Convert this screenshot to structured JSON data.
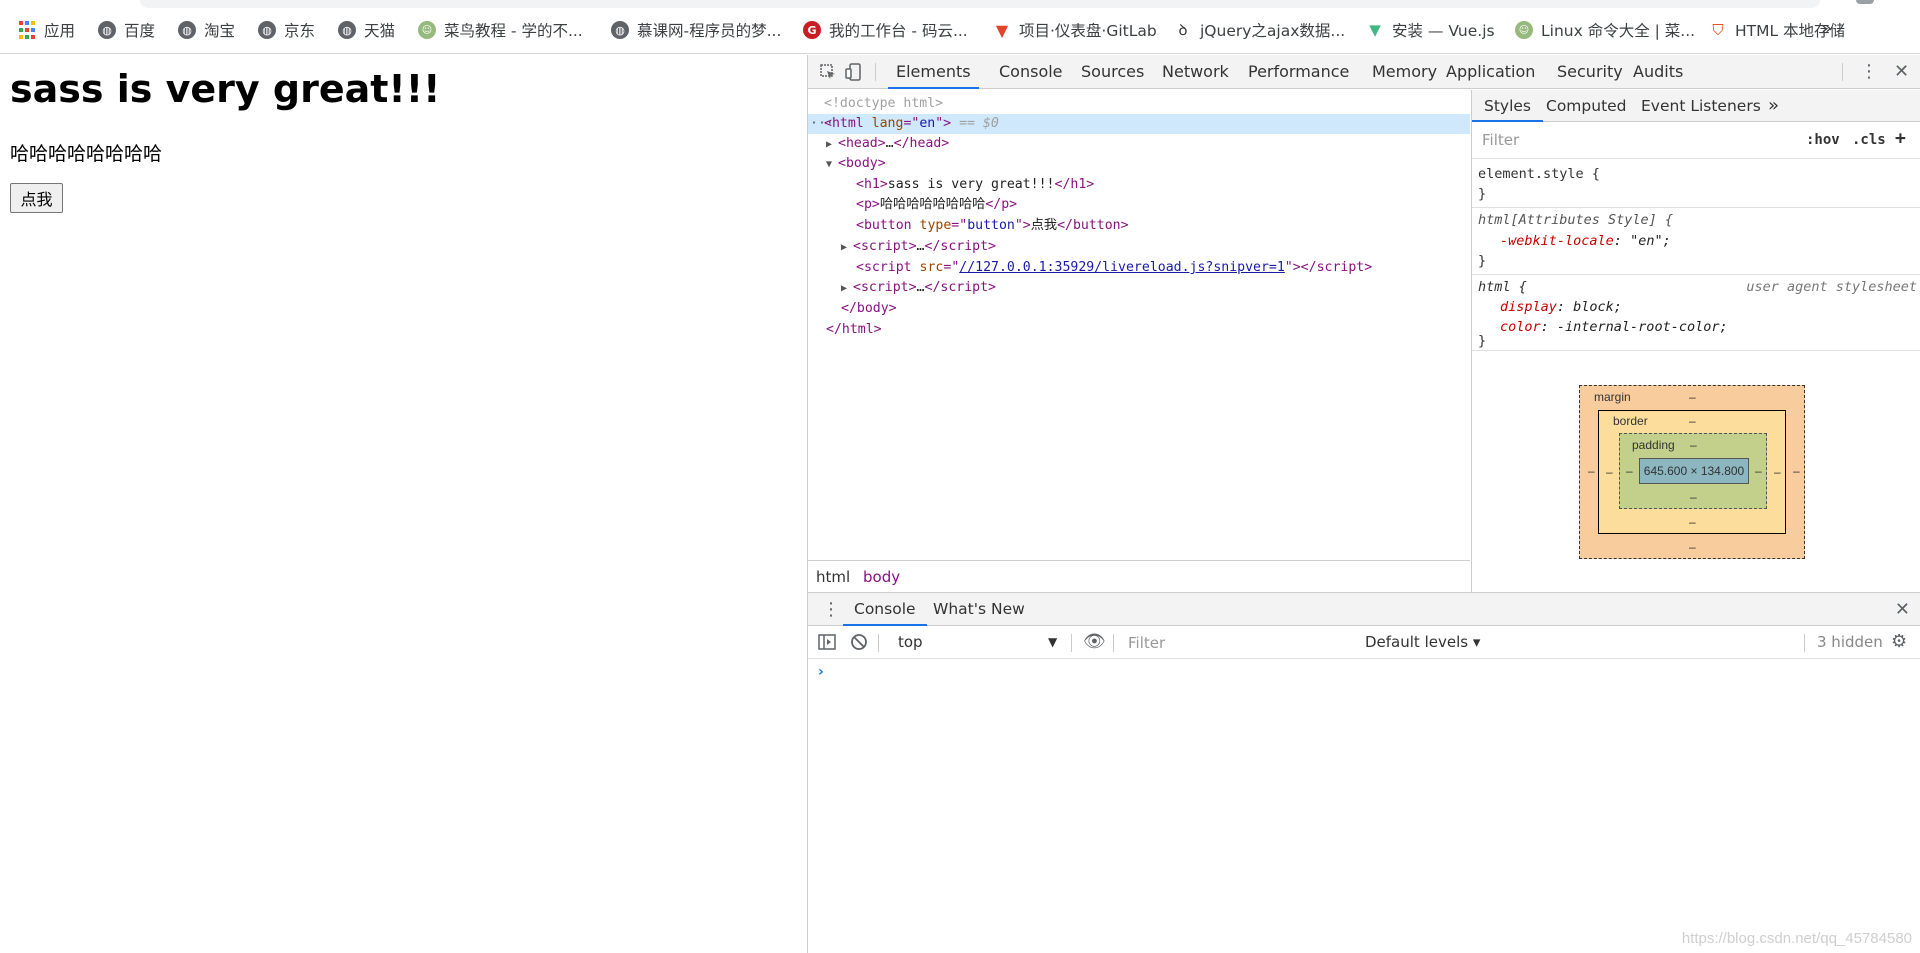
{
  "bookmarks": {
    "items": [
      {
        "label": "应用",
        "icon": "apps-grid-icon"
      },
      {
        "label": "百度",
        "icon": "globe-icon"
      },
      {
        "label": "淘宝",
        "icon": "globe-icon"
      },
      {
        "label": "京东",
        "icon": "globe-icon"
      },
      {
        "label": "天猫",
        "icon": "globe-icon"
      },
      {
        "label": "菜鸟教程 - 学的不...",
        "icon": "runoob-icon"
      },
      {
        "label": "慕课网-程序员的梦...",
        "icon": "globe-icon"
      },
      {
        "label": "我的工作台 - 码云...",
        "icon": "gitee-icon"
      },
      {
        "label": "项目·仪表盘·GitLab",
        "icon": "gitlab-icon"
      },
      {
        "label": "jQuery之ajax数据...",
        "icon": "bookmark-icon"
      },
      {
        "label": "安装 — Vue.js",
        "icon": "vue-icon"
      },
      {
        "label": "Linux 命令大全 | 菜...",
        "icon": "runoob-icon"
      },
      {
        "label": "HTML 本地存储",
        "icon": "html5-icon"
      }
    ],
    "more": "»"
  },
  "page": {
    "heading": "sass is very great!!!",
    "paragraph": "哈哈哈哈哈哈哈哈",
    "button": "点我"
  },
  "devtools": {
    "tabs": [
      "Elements",
      "Console",
      "Sources",
      "Network",
      "Performance",
      "Memory",
      "Application",
      "Security",
      "Audits"
    ],
    "active_tab": "Elements",
    "tree": {
      "doctype": "<!doctype html>",
      "html_open_tag": "html",
      "html_lang_attr": "lang",
      "html_lang_val": "en",
      "sel_marker": "== $0",
      "head": "head",
      "body": "body",
      "h1_text": "sass is very great!!!",
      "p_text": "哈哈哈哈哈哈哈哈",
      "button_type_attr": "type",
      "button_type_val": "button",
      "button_text": "点我",
      "script": "script",
      "script_src_attr": "src",
      "script_src_val": "//127.0.0.1:35929/livereload.js?snipver=1",
      "ellipsis": "…"
    },
    "breadcrumb": [
      "html",
      "body"
    ],
    "styles": {
      "tabs": [
        "Styles",
        "Computed",
        "Event Listeners",
        "»"
      ],
      "filter_placeholder": "Filter",
      "hov": ":hov",
      "cls": ".cls",
      "plus": "+",
      "rules": {
        "element_style": "element.style {",
        "attr_style_selector": "html[Attributes Style] {",
        "webkit_locale_prop": "-webkit-locale",
        "webkit_locale_val": "\"en\";",
        "html_selector": "html {",
        "ua_label": "user agent stylesheet",
        "display_prop": "display",
        "display_val": "block;",
        "color_prop": "color",
        "color_val": "-internal-root-color;",
        "close": "}"
      },
      "box_model": {
        "margin_label": "margin",
        "border_label": "border",
        "padding_label": "padding",
        "content": "645.600 × 134.800",
        "dash": "–"
      }
    },
    "drawer": {
      "tabs": [
        "Console",
        "What's New"
      ],
      "active_tab": "Console",
      "context": "top",
      "filter_placeholder": "Filter",
      "levels": "Default levels ▾",
      "hidden": "3 hidden",
      "prompt": "›"
    }
  },
  "watermark": "https://blog.csdn.net/qq_45784580",
  "colors": {
    "accent": "#1a73e8",
    "tag": "#881280",
    "attr_name": "#994500",
    "attr_value": "#1a1aa6",
    "selected_row": "#cfe8fc",
    "margin": "#f9cc9d",
    "border": "#fddd9b",
    "padding": "#c3d08b",
    "content": "#8cb6c0"
  }
}
